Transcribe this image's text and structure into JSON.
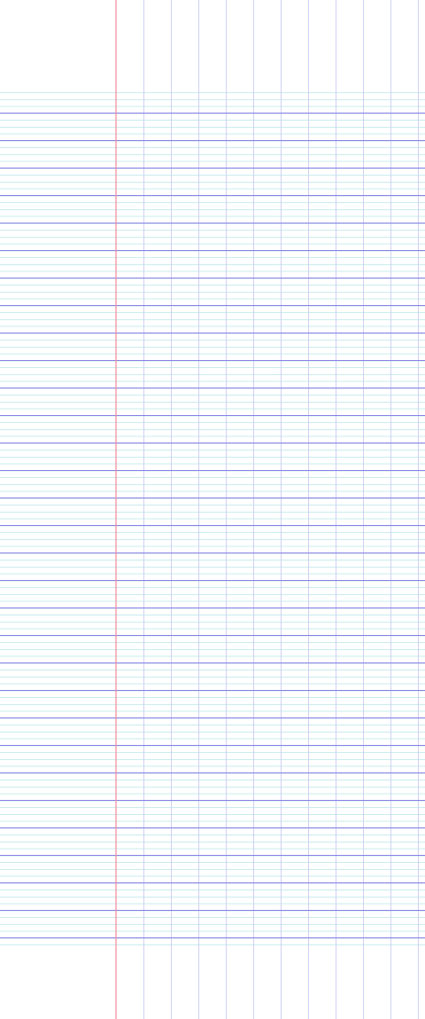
{
  "page": {
    "kind": "seyes-ruled-notebook-paper",
    "paper_color": "#ffffff"
  },
  "colors": {
    "margin_line": "#f08a9a",
    "main_horizontal_line": "#8a7fe6",
    "fine_horizontal_line": "#b9e6e8",
    "vertical_line": "#c9cdf2"
  }
}
